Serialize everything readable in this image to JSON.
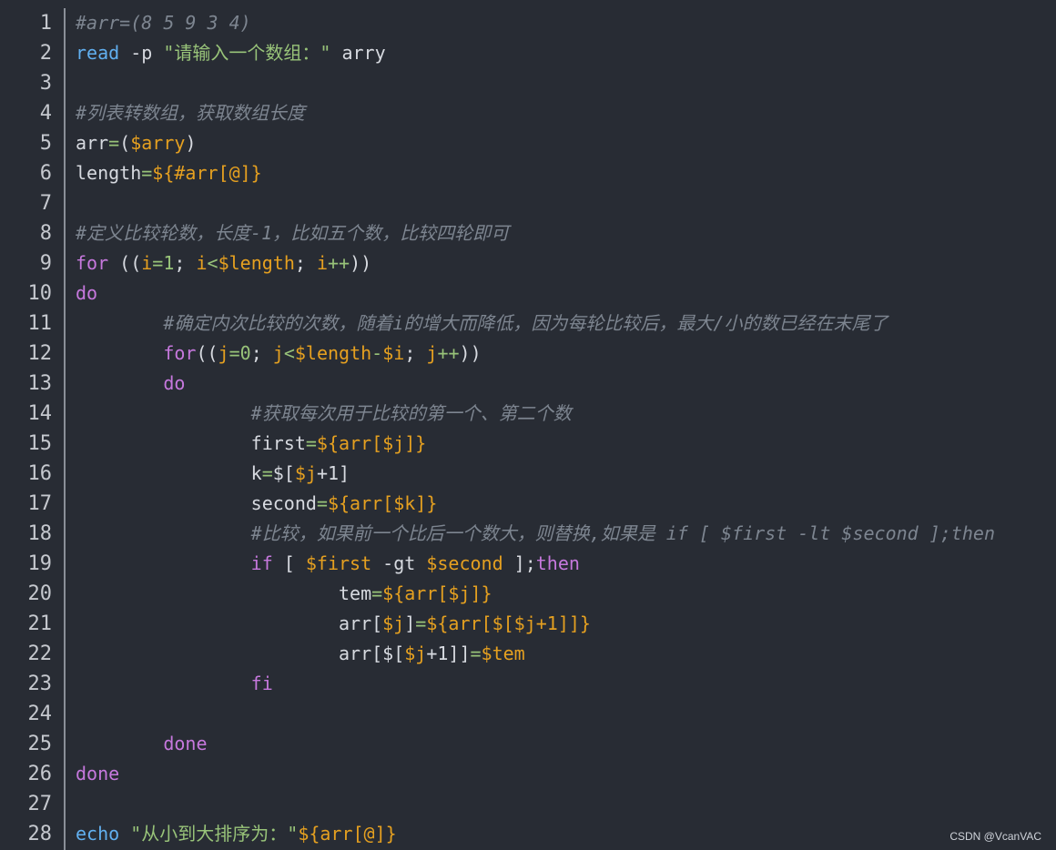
{
  "colors": {
    "background": "#282c34",
    "line_number": "#c5c8ce",
    "gutter_border": "#8a8f98",
    "default_text": "#d7dae0",
    "comment": "#7d8590",
    "command_keyword": "#61afef",
    "control_keyword": "#c678dd",
    "string": "#98c379",
    "variable": "#e5a020",
    "operator": "#98c379",
    "number": "#98c379",
    "watermark": "#cfd3da"
  },
  "watermark": "CSDN @VcanVAC",
  "lines": [
    {
      "number": "1",
      "tokens": [
        {
          "text": "#arr=(8 5 9 3 4)",
          "type": "comment"
        }
      ]
    },
    {
      "number": "2",
      "tokens": [
        {
          "text": "read",
          "type": "command_keyword"
        },
        {
          "text": " -p ",
          "type": "default_text"
        },
        {
          "text": "\"请输入一个数组：\"",
          "type": "string"
        },
        {
          "text": " arry",
          "type": "default_text"
        }
      ]
    },
    {
      "number": "3",
      "tokens": []
    },
    {
      "number": "4",
      "tokens": [
        {
          "text": "#列表转数组，获取数组长度",
          "type": "comment"
        }
      ]
    },
    {
      "number": "5",
      "tokens": [
        {
          "text": "arr",
          "type": "default_text"
        },
        {
          "text": "=",
          "type": "operator"
        },
        {
          "text": "(",
          "type": "default_text"
        },
        {
          "text": "$arry",
          "type": "variable"
        },
        {
          "text": ")",
          "type": "default_text"
        }
      ]
    },
    {
      "number": "6",
      "tokens": [
        {
          "text": "length",
          "type": "default_text"
        },
        {
          "text": "=",
          "type": "operator"
        },
        {
          "text": "${#arr[@]}",
          "type": "variable"
        }
      ]
    },
    {
      "number": "7",
      "tokens": []
    },
    {
      "number": "8",
      "tokens": [
        {
          "text": "#定义比较轮数，长度-1，比如五个数，比较四轮即可",
          "type": "comment"
        }
      ]
    },
    {
      "number": "9",
      "tokens": [
        {
          "text": "for",
          "type": "control_keyword"
        },
        {
          "text": " ((",
          "type": "default_text"
        },
        {
          "text": "i",
          "type": "variable"
        },
        {
          "text": "=",
          "type": "operator"
        },
        {
          "text": "1",
          "type": "number"
        },
        {
          "text": "; ",
          "type": "default_text"
        },
        {
          "text": "i",
          "type": "variable"
        },
        {
          "text": "<",
          "type": "operator"
        },
        {
          "text": "$length",
          "type": "variable"
        },
        {
          "text": "; ",
          "type": "default_text"
        },
        {
          "text": "i",
          "type": "variable"
        },
        {
          "text": "++",
          "type": "operator"
        },
        {
          "text": "))",
          "type": "default_text"
        }
      ]
    },
    {
      "number": "10",
      "tokens": [
        {
          "text": "do",
          "type": "control_keyword"
        }
      ]
    },
    {
      "number": "11",
      "tokens": [
        {
          "text": "        ",
          "type": "default_text"
        },
        {
          "text": "#确定内次比较的次数，随着i的增大而降低，因为每轮比较后，最大/小的数已经在末尾了",
          "type": "comment"
        }
      ]
    },
    {
      "number": "12",
      "tokens": [
        {
          "text": "        ",
          "type": "default_text"
        },
        {
          "text": "for",
          "type": "control_keyword"
        },
        {
          "text": "((",
          "type": "default_text"
        },
        {
          "text": "j",
          "type": "variable"
        },
        {
          "text": "=",
          "type": "operator"
        },
        {
          "text": "0",
          "type": "number"
        },
        {
          "text": "; ",
          "type": "default_text"
        },
        {
          "text": "j",
          "type": "variable"
        },
        {
          "text": "<",
          "type": "operator"
        },
        {
          "text": "$length",
          "type": "variable"
        },
        {
          "text": "-",
          "type": "operator"
        },
        {
          "text": "$i",
          "type": "variable"
        },
        {
          "text": "; ",
          "type": "default_text"
        },
        {
          "text": "j",
          "type": "variable"
        },
        {
          "text": "++",
          "type": "operator"
        },
        {
          "text": "))",
          "type": "default_text"
        }
      ]
    },
    {
      "number": "13",
      "tokens": [
        {
          "text": "        ",
          "type": "default_text"
        },
        {
          "text": "do",
          "type": "control_keyword"
        }
      ]
    },
    {
      "number": "14",
      "tokens": [
        {
          "text": "                ",
          "type": "default_text"
        },
        {
          "text": "#获取每次用于比较的第一个、第二个数",
          "type": "comment"
        }
      ]
    },
    {
      "number": "15",
      "tokens": [
        {
          "text": "                first",
          "type": "default_text"
        },
        {
          "text": "=",
          "type": "operator"
        },
        {
          "text": "${arr[$j]}",
          "type": "variable"
        }
      ]
    },
    {
      "number": "16",
      "tokens": [
        {
          "text": "                k",
          "type": "default_text"
        },
        {
          "text": "=",
          "type": "operator"
        },
        {
          "text": "$[",
          "type": "default_text"
        },
        {
          "text": "$j",
          "type": "variable"
        },
        {
          "text": "+1]",
          "type": "default_text"
        }
      ]
    },
    {
      "number": "17",
      "tokens": [
        {
          "text": "                second",
          "type": "default_text"
        },
        {
          "text": "=",
          "type": "operator"
        },
        {
          "text": "${arr[$k]}",
          "type": "variable"
        }
      ]
    },
    {
      "number": "18",
      "tokens": [
        {
          "text": "                ",
          "type": "default_text"
        },
        {
          "text": "#比较，如果前一个比后一个数大，则替换,如果是 if [ $first -lt $second ];then",
          "type": "comment"
        }
      ]
    },
    {
      "number": "19",
      "tokens": [
        {
          "text": "                ",
          "type": "default_text"
        },
        {
          "text": "if",
          "type": "control_keyword"
        },
        {
          "text": " [ ",
          "type": "default_text"
        },
        {
          "text": "$first",
          "type": "variable"
        },
        {
          "text": " -gt ",
          "type": "default_text"
        },
        {
          "text": "$second",
          "type": "variable"
        },
        {
          "text": " ];",
          "type": "default_text"
        },
        {
          "text": "then",
          "type": "control_keyword"
        }
      ]
    },
    {
      "number": "20",
      "tokens": [
        {
          "text": "                        tem",
          "type": "default_text"
        },
        {
          "text": "=",
          "type": "operator"
        },
        {
          "text": "${arr[$j]}",
          "type": "variable"
        }
      ]
    },
    {
      "number": "21",
      "tokens": [
        {
          "text": "                        arr[",
          "type": "default_text"
        },
        {
          "text": "$j",
          "type": "variable"
        },
        {
          "text": "]",
          "type": "default_text"
        },
        {
          "text": "=",
          "type": "operator"
        },
        {
          "text": "${arr[$[$j+1]]}",
          "type": "variable"
        }
      ]
    },
    {
      "number": "22",
      "tokens": [
        {
          "text": "                        arr[$[",
          "type": "default_text"
        },
        {
          "text": "$j",
          "type": "variable"
        },
        {
          "text": "+1]]",
          "type": "default_text"
        },
        {
          "text": "=",
          "type": "operator"
        },
        {
          "text": "$tem",
          "type": "variable"
        }
      ]
    },
    {
      "number": "23",
      "tokens": [
        {
          "text": "                ",
          "type": "default_text"
        },
        {
          "text": "fi",
          "type": "control_keyword"
        }
      ]
    },
    {
      "number": "24",
      "tokens": []
    },
    {
      "number": "25",
      "tokens": [
        {
          "text": "        ",
          "type": "default_text"
        },
        {
          "text": "done",
          "type": "control_keyword"
        }
      ]
    },
    {
      "number": "26",
      "tokens": [
        {
          "text": "done",
          "type": "control_keyword"
        }
      ]
    },
    {
      "number": "27",
      "tokens": []
    },
    {
      "number": "28",
      "tokens": [
        {
          "text": "echo",
          "type": "command_keyword"
        },
        {
          "text": " ",
          "type": "default_text"
        },
        {
          "text": "\"从小到大排序为：\"",
          "type": "string"
        },
        {
          "text": "${arr[@]}",
          "type": "variable"
        }
      ]
    }
  ]
}
